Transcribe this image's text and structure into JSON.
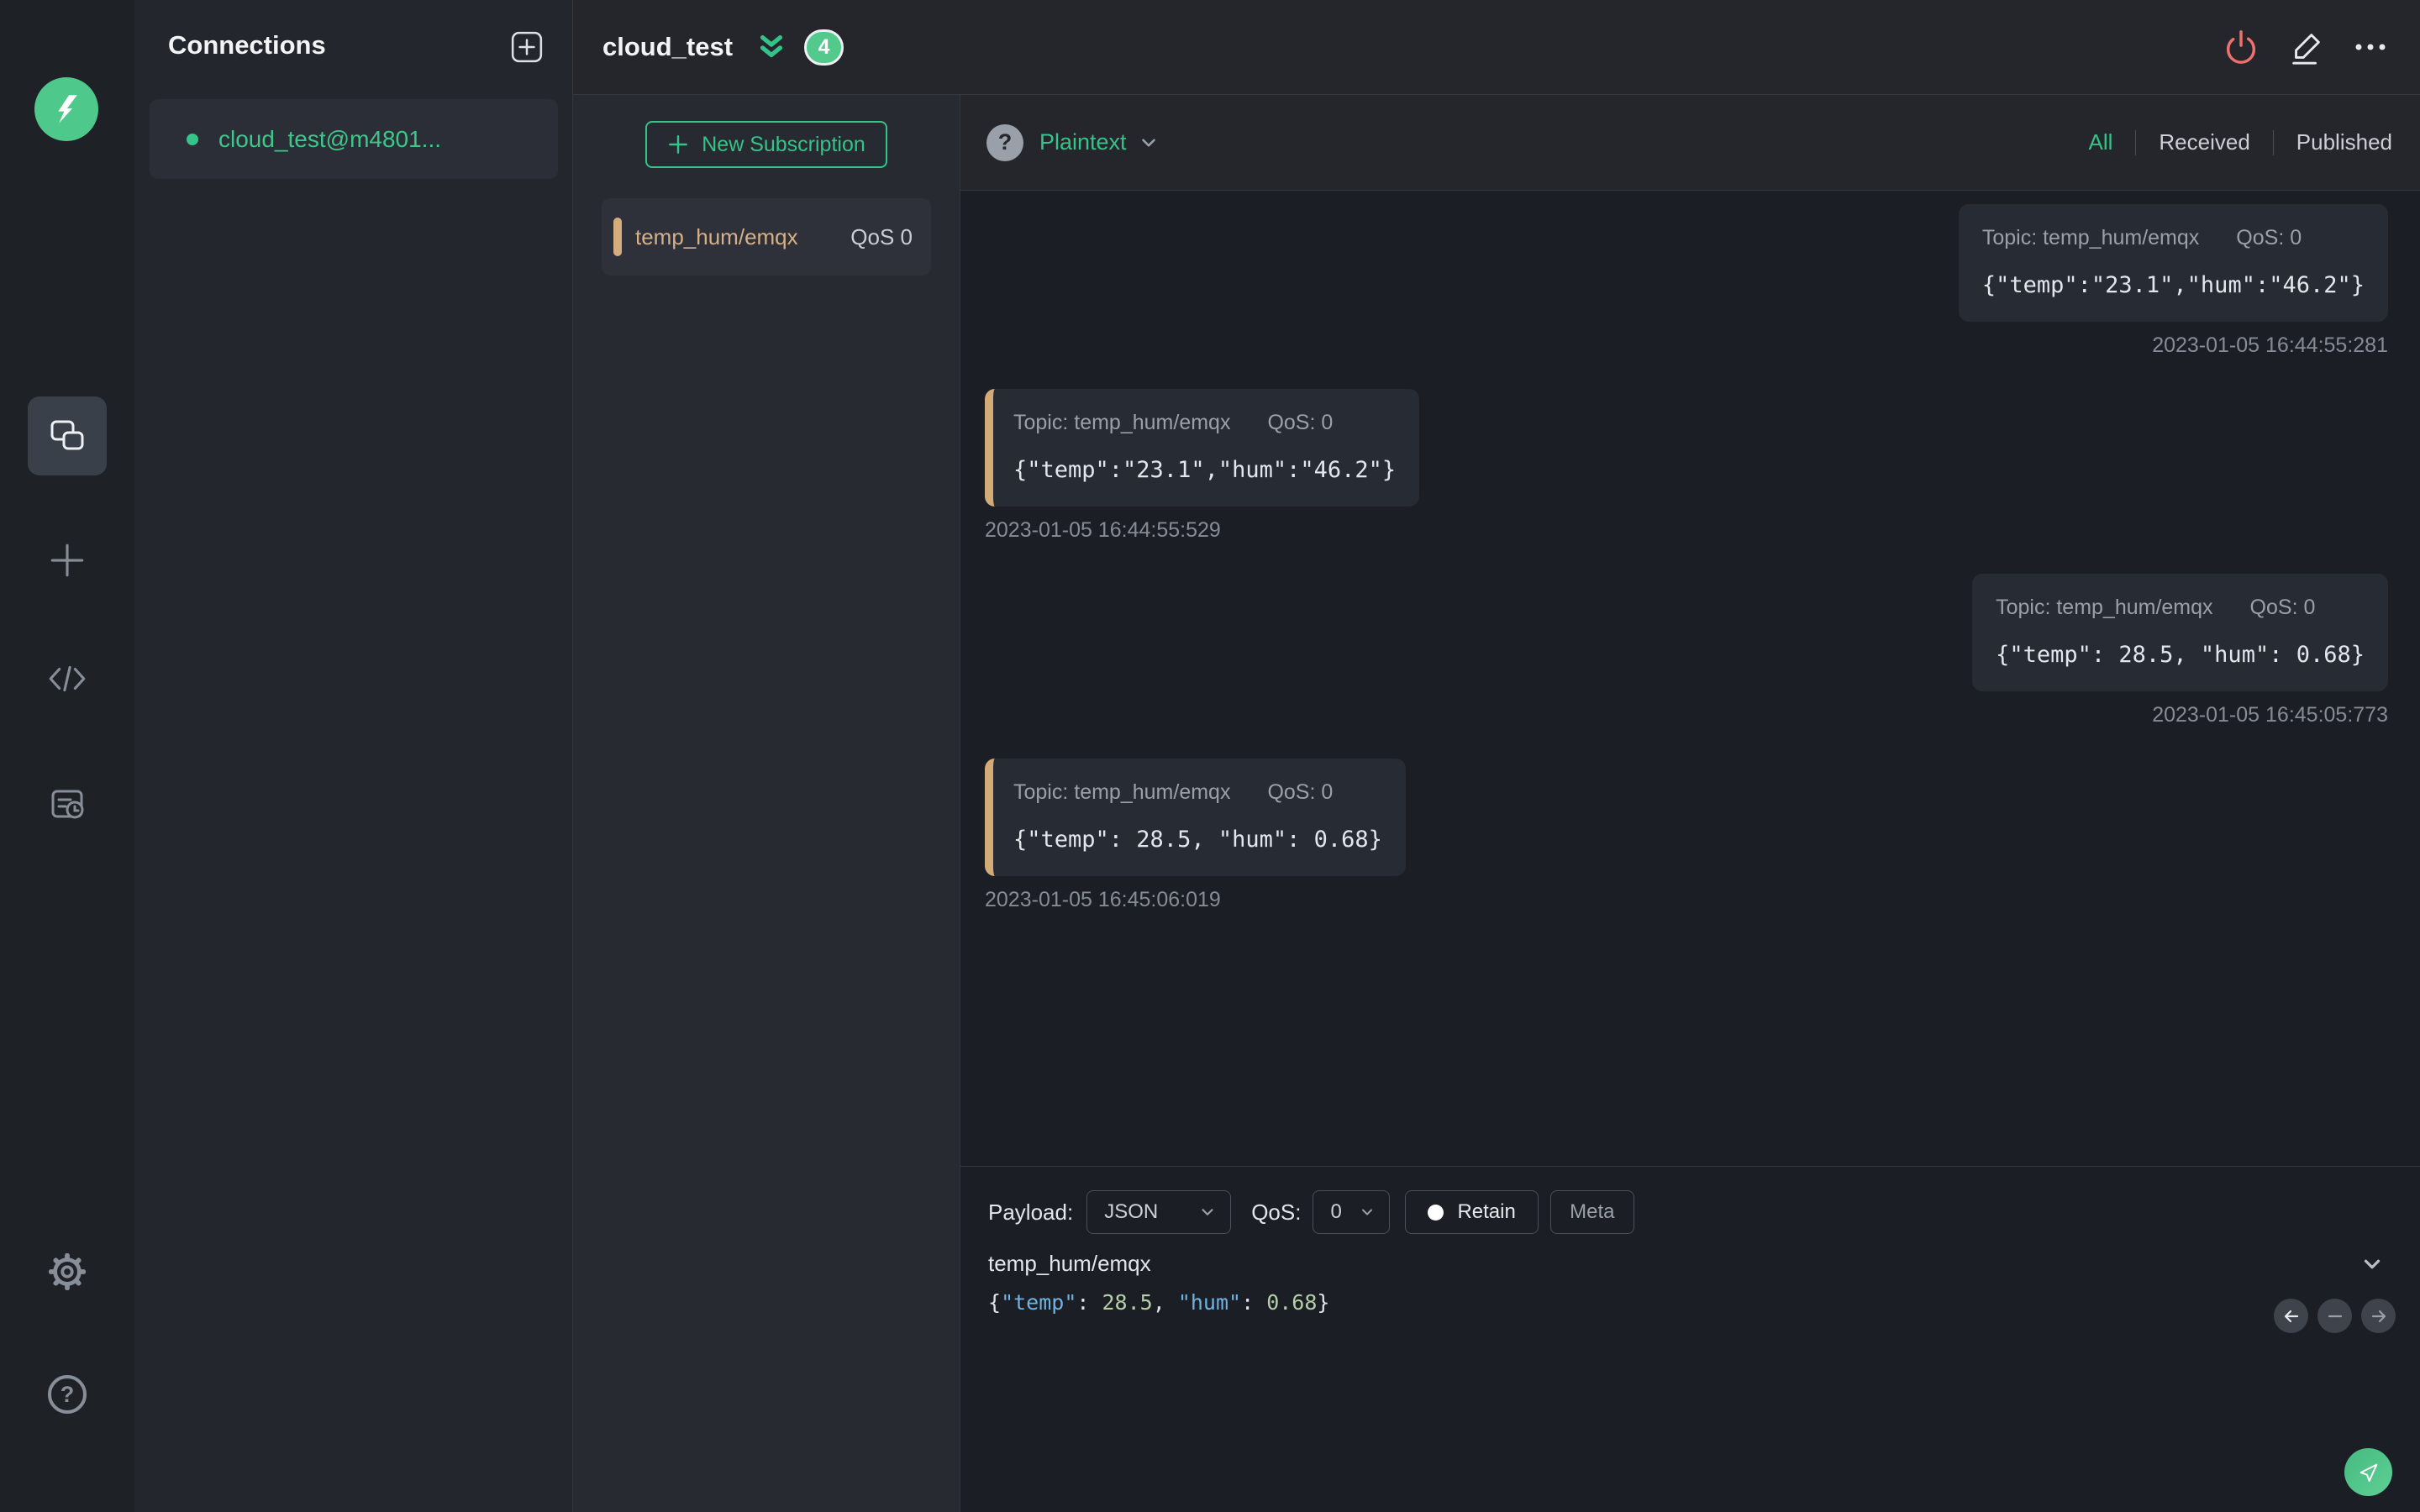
{
  "colors": {
    "accent_green": "#34c388",
    "danger_red": "#ed726b",
    "subscription_tan": "#d4ad7e",
    "badge_green": "#53c98c"
  },
  "connections": {
    "title": "Connections",
    "items": [
      {
        "name": "cloud_test@m4801...",
        "status": "connected"
      }
    ]
  },
  "header": {
    "title": "cloud_test",
    "badge": "4"
  },
  "subscriptions": {
    "new_button_label": "New Subscription",
    "items": [
      {
        "topic": "temp_hum/emqx",
        "qos": "QoS 0"
      }
    ]
  },
  "filter_bar": {
    "format": "Plaintext",
    "tabs": [
      "All",
      "Received",
      "Published"
    ],
    "active_tab": "All"
  },
  "messages": [
    {
      "type": "published",
      "topic_label": "Topic: temp_hum/emqx",
      "qos_label": "QoS: 0",
      "payload": "{\"temp\":\"23.1\",\"hum\":\"46.2\"}",
      "time": "2023-01-05 16:44:55:281"
    },
    {
      "type": "received",
      "topic_label": "Topic: temp_hum/emqx",
      "qos_label": "QoS: 0",
      "payload": "{\"temp\":\"23.1\",\"hum\":\"46.2\"}",
      "time": "2023-01-05 16:44:55:529"
    },
    {
      "type": "published",
      "topic_label": "Topic: temp_hum/emqx",
      "qos_label": "QoS: 0",
      "payload": "{\"temp\": 28.5, \"hum\": 0.68}",
      "time": "2023-01-05 16:45:05:773"
    },
    {
      "type": "received",
      "topic_label": "Topic: temp_hum/emqx",
      "qos_label": "QoS: 0",
      "payload": "{\"temp\": 28.5, \"hum\": 0.68}",
      "time": "2023-01-05 16:45:06:019"
    }
  ],
  "publish": {
    "payload_label": "Payload:",
    "payload_format": "JSON",
    "qos_label": "QoS:",
    "qos_value": "0",
    "retain_label": "Retain",
    "meta_label": "Meta",
    "topic": "temp_hum/emqx",
    "payload_tokens": [
      {
        "text": "{",
        "type": "plain"
      },
      {
        "text": "\"temp\"",
        "type": "key"
      },
      {
        "text": ": ",
        "type": "plain"
      },
      {
        "text": "28.5",
        "type": "num"
      },
      {
        "text": ", ",
        "type": "plain"
      },
      {
        "text": "\"hum\"",
        "type": "key"
      },
      {
        "text": ": ",
        "type": "plain"
      },
      {
        "text": "0.68",
        "type": "num"
      },
      {
        "text": "}",
        "type": "plain"
      }
    ]
  }
}
